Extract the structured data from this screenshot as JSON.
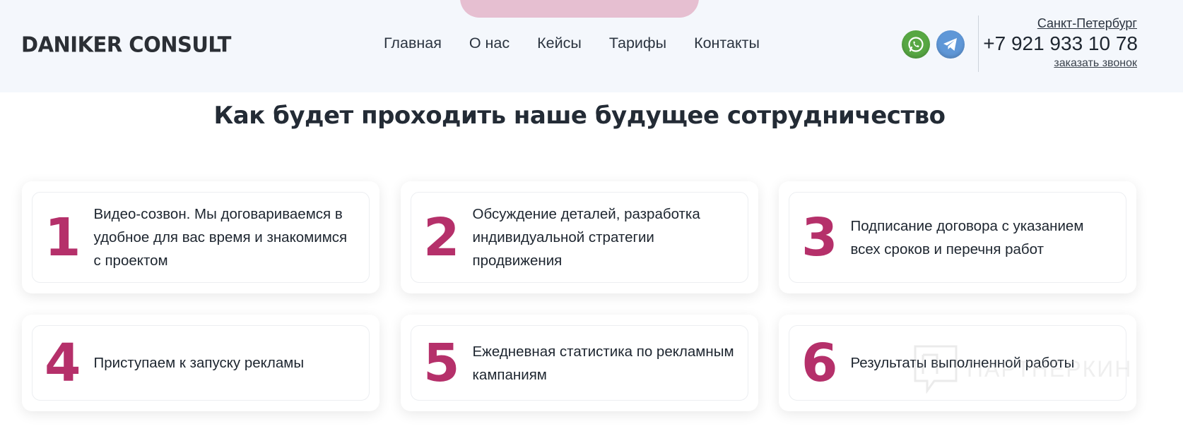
{
  "header": {
    "logo": "DANIKER CONSULT",
    "nav": [
      "Главная",
      "О нас",
      "Кейсы",
      "Тарифы",
      "Контакты"
    ],
    "social_icons": [
      "whatsapp-icon",
      "telegram-icon"
    ],
    "city": "Санкт-Петербург",
    "phone": "+7 921 933 10 78",
    "callback": "заказать звонок"
  },
  "section": {
    "title": "Как будет проходить наше будущее сотрудничество"
  },
  "steps": [
    {
      "number": "1",
      "text": "Видео-созвон. Мы договариваемся в удобное для вас время и знакомимся с проектом"
    },
    {
      "number": "2",
      "text": "Обсуждение деталей, разработка индивидуальной стратегии продвижения"
    },
    {
      "number": "3",
      "text": "Подписание договора с указанием всех сроков и перечня работ"
    },
    {
      "number": "4",
      "text": "Приступаем к запуску рекламы"
    },
    {
      "number": "5",
      "text": "Ежедневная статистика по рекламным кампаниям"
    },
    {
      "number": "6",
      "text": "Результаты выполненной работы"
    }
  ],
  "watermark": "ПАРТНЕРКИН",
  "colors": {
    "accent": "#b5306a",
    "header_bg": "#f4f7fc",
    "whatsapp": "#57a743",
    "telegram": "#5f97d7",
    "pill": "#e6bfd1"
  }
}
